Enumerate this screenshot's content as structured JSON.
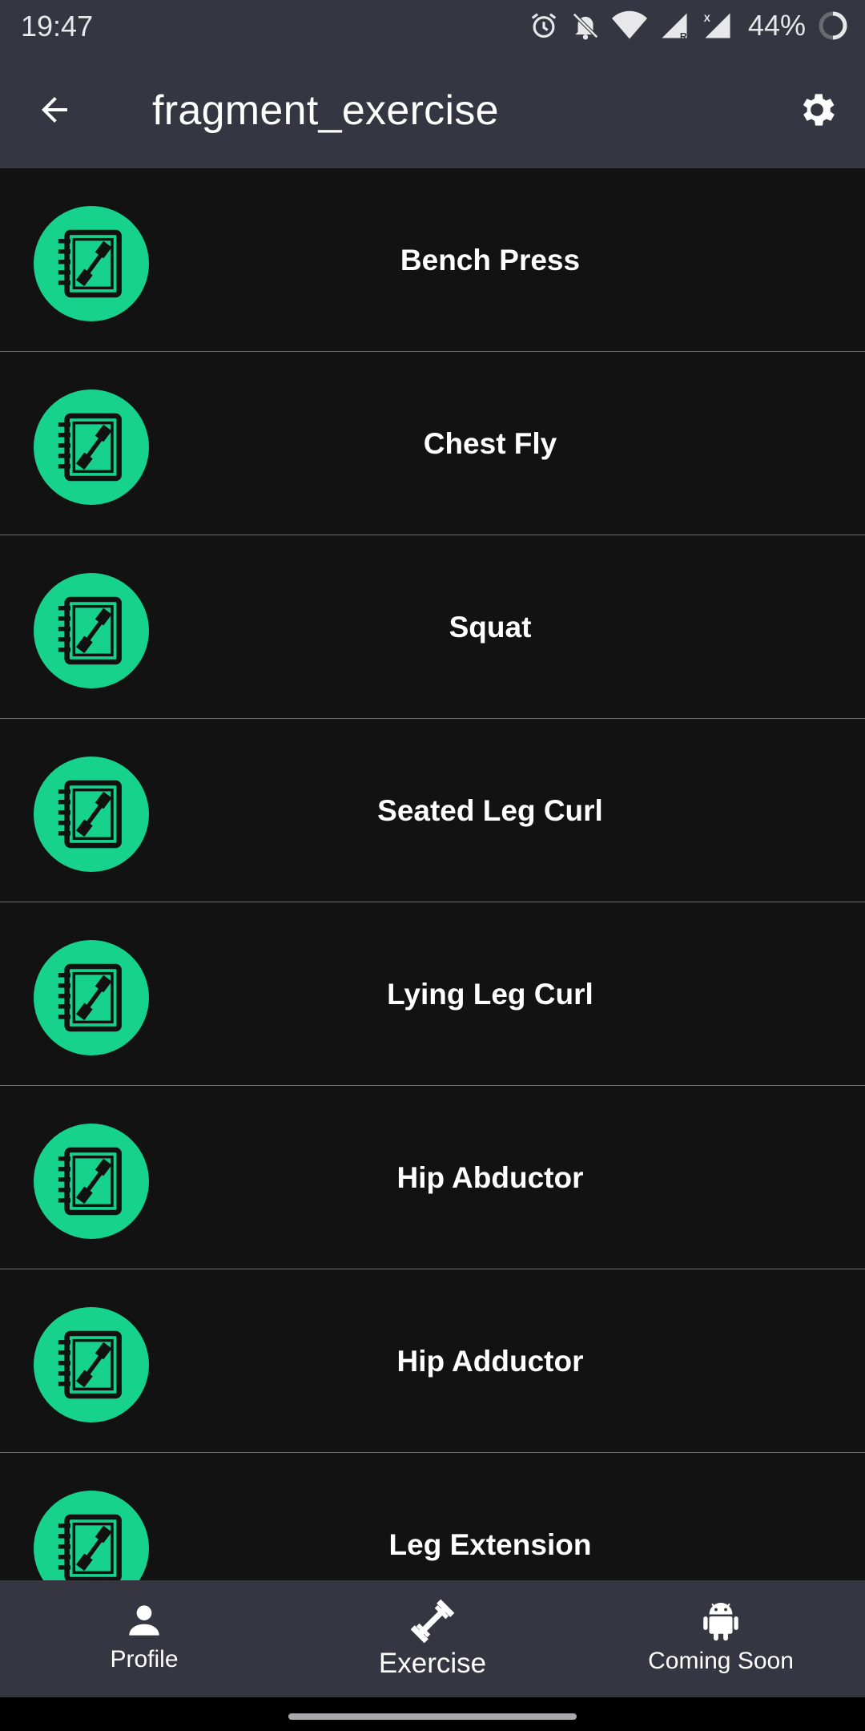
{
  "status_bar": {
    "time": "19:47",
    "battery": "44%",
    "icons": [
      "alarm-icon",
      "notifications-off-icon",
      "wifi-icon",
      "signal-roaming-icon",
      "signal-icon",
      "battery-icon"
    ]
  },
  "app_bar": {
    "title": "fragment_exercise",
    "back_icon": "arrow-back-icon",
    "settings_icon": "gear-icon"
  },
  "exercises": [
    {
      "name": "Bench Press"
    },
    {
      "name": "Chest Fly"
    },
    {
      "name": "Squat"
    },
    {
      "name": "Seated Leg Curl"
    },
    {
      "name": "Lying Leg Curl"
    },
    {
      "name": "Hip Abductor"
    },
    {
      "name": "Hip Adductor"
    },
    {
      "name": "Leg Extension"
    }
  ],
  "bottom_nav": {
    "items": [
      {
        "label": "Profile",
        "icon": "person-icon"
      },
      {
        "label": "Exercise",
        "icon": "dumbbell-icon"
      },
      {
        "label": "Coming Soon",
        "icon": "android-icon"
      }
    ],
    "active": "Exercise"
  },
  "colors": {
    "accent": "#17d28d",
    "bar_background": "#353641",
    "list_background": "#121213"
  }
}
